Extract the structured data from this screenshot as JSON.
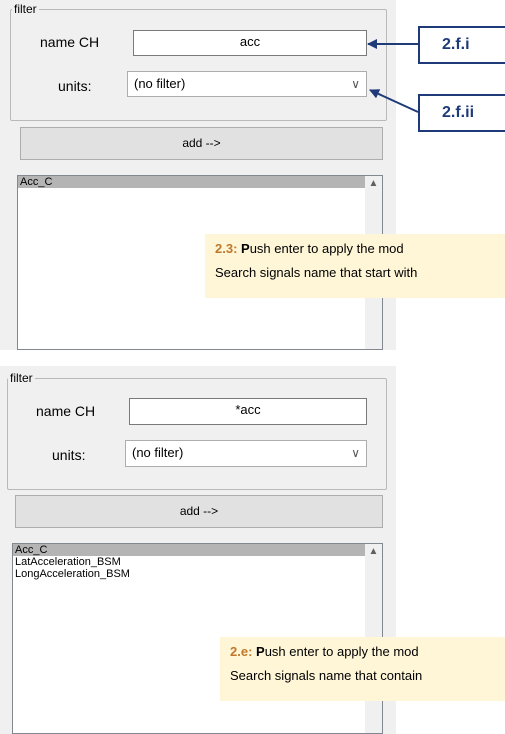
{
  "panel1": {
    "filter_legend": "filter",
    "name_label": "name CH",
    "name_value": "acc",
    "units_label": "units:",
    "units_value": "(no filter)",
    "add_button": "add -->",
    "list_items": [
      "Acc_C"
    ],
    "note": {
      "prefix": "2.3:",
      "first_letter": "P",
      "line1_rest": "ush enter to apply the mod",
      "line2": "Search signals name that start with"
    }
  },
  "panel2": {
    "filter_legend": "filter",
    "name_label": "name CH",
    "name_value": "*acc",
    "units_label": "units:",
    "units_value": "(no filter)",
    "add_button": "add -->",
    "list_items": [
      "Acc_C",
      "LatAcceleration_BSM",
      "LongAcceleration_BSM"
    ],
    "note": {
      "prefix": "2.e:",
      "first_letter": "P",
      "line1_rest": "ush enter to apply the mod",
      "line2": "Search signals name that contain"
    }
  },
  "callouts": {
    "first": "2.f.i",
    "second": "2.f.ii"
  },
  "colors": {
    "panel_bg": "#f0f0f0",
    "note_bg": "#fff6d8",
    "note_accent": "#c0782a",
    "callout_blue": "#1f3a78",
    "selected_row": "#b4b4b4"
  },
  "icons": {
    "dropdown": "chevron-down-icon",
    "scroll_up": "scroll-up-arrow-icon"
  }
}
